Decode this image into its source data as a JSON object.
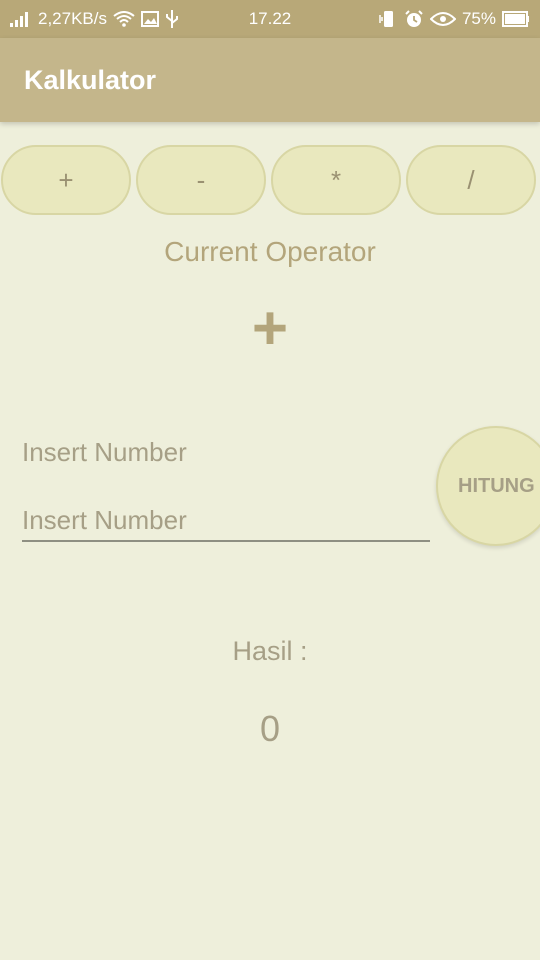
{
  "status_bar": {
    "speed": "2,27KB/s",
    "time": "17.22",
    "battery": "75%",
    "icons_left": [
      "signal-icon",
      "wifi-icon",
      "image-icon",
      "usb-icon"
    ],
    "icons_right": [
      "vibrate-icon",
      "alarm-icon",
      "eye-icon",
      "battery-icon"
    ]
  },
  "app_bar": {
    "title": "Kalkulator"
  },
  "operators": [
    {
      "label": "+"
    },
    {
      "label": "-"
    },
    {
      "label": "*"
    },
    {
      "label": "/"
    }
  ],
  "current_operator": {
    "label": "Current Operator",
    "value": "+"
  },
  "insert": {
    "label": "Insert Number",
    "placeholder": "Insert Number",
    "value": ""
  },
  "hitung_button": {
    "label": "HITUNG"
  },
  "hasil": {
    "label": "Hasil :",
    "value": "0"
  },
  "colors": {
    "status_bar": "#B8A878",
    "app_bar": "#C4B68B",
    "background": "#EEEFDB",
    "button_fill": "#E9E8BE",
    "accent_text": "#B3A57B"
  }
}
